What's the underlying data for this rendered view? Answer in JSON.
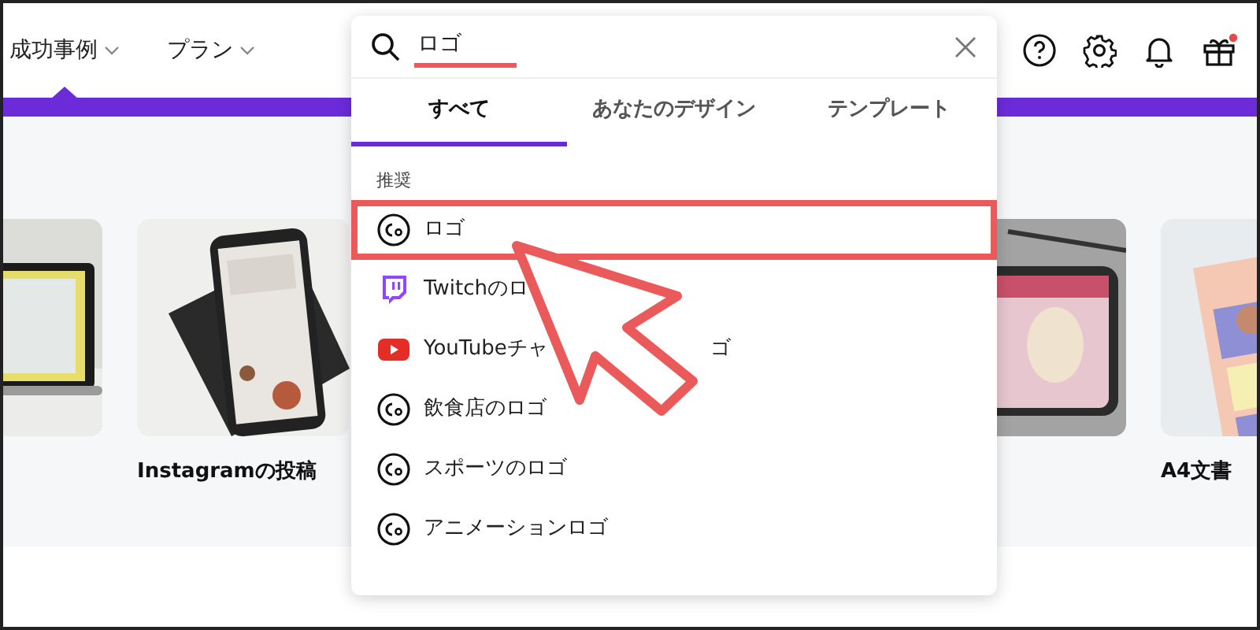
{
  "nav": [
    {
      "label": "成功事例"
    },
    {
      "label": "プラン"
    }
  ],
  "header_icons": {
    "gift_badge": true
  },
  "cards": [
    {
      "kind": "picture"
    },
    {
      "kind": "picture",
      "label": "Instagramの投稿"
    },
    {
      "kind": "picture"
    },
    {
      "kind": "picture",
      "label": "A4文書"
    }
  ],
  "search": {
    "value": "ロゴ",
    "underlined": true
  },
  "tabs": [
    {
      "label": "すべて",
      "selected": true
    },
    {
      "label": "あなたのデザイン",
      "selected": false
    },
    {
      "label": "テンプレート",
      "selected": false
    }
  ],
  "section_title": "推奨",
  "suggestions": [
    {
      "kind": "logo",
      "label": "ロゴ",
      "highlighted": true
    },
    {
      "kind": "chat",
      "label": "Twitchのロ",
      "highlighted": false
    },
    {
      "kind": "video",
      "label": "YouTubeチャ",
      "tail": "ゴ",
      "highlighted": false
    },
    {
      "kind": "logo",
      "label": "飲食店のロゴ",
      "highlighted": false
    },
    {
      "kind": "logo",
      "label": "スポーツのロゴ",
      "highlighted": false
    },
    {
      "kind": "logo",
      "label": "アニメーションロゴ",
      "highlighted": false
    }
  ]
}
